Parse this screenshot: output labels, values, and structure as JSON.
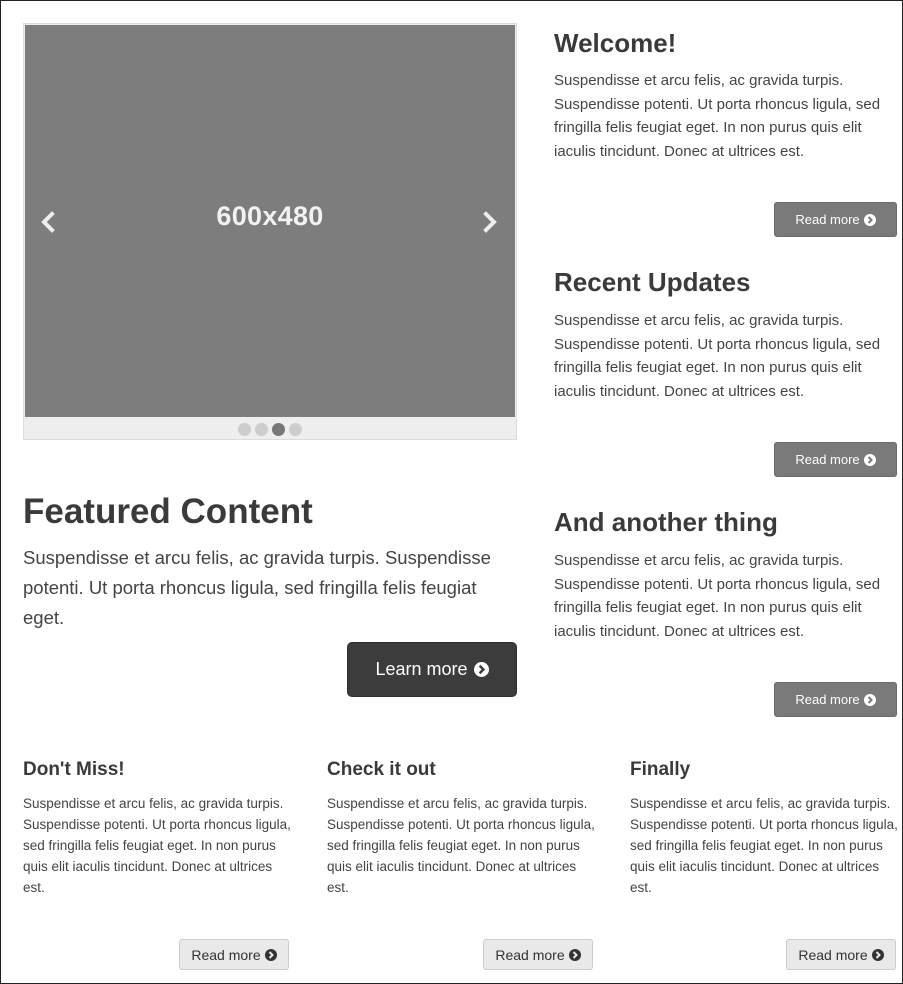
{
  "carousel": {
    "caption": "600x480",
    "prev_icon": "chevron-left-icon",
    "next_icon": "chevron-right-icon",
    "slide_count": 4,
    "active_slide": 3
  },
  "side_sections": [
    {
      "heading": "Welcome!",
      "text": "Suspendisse et arcu felis, ac gravida turpis. Suspendisse potenti. Ut porta rhoncus ligula, sed fringilla felis feugiat eget. In non purus quis elit iaculis tincidunt. Donec at ultrices est.",
      "button_label": "Read more"
    },
    {
      "heading": "Recent Updates",
      "text": "Suspendisse et arcu felis, ac gravida turpis. Suspendisse potenti. Ut porta rhoncus ligula, sed fringilla felis feugiat eget. In non purus quis elit iaculis tincidunt. Donec at ultrices est.",
      "button_label": "Read more"
    },
    {
      "heading": "And another thing",
      "text": "Suspendisse et arcu felis, ac gravida turpis. Suspendisse potenti. Ut porta rhoncus ligula, sed fringilla felis feugiat eget. In non purus quis elit iaculis tincidunt. Donec at ultrices est.",
      "button_label": "Read more"
    }
  ],
  "featured": {
    "heading": "Featured Content",
    "text": "Suspendisse et arcu felis, ac gravida turpis. Suspendisse potenti. Ut porta rhoncus ligula, sed fringilla felis feugiat eget.",
    "button_label": "Learn more"
  },
  "columns": [
    {
      "heading": "Don't Miss!",
      "text": "Suspendisse et arcu felis, ac gravida turpis. Suspendisse potenti. Ut porta rhoncus ligula, sed fringilla felis feugiat eget. In non purus quis elit iaculis tincidunt. Donec at ultrices est.",
      "button_label": "Read more"
    },
    {
      "heading": "Check it out",
      "text": "Suspendisse et arcu felis, ac gravida turpis. Suspendisse potenti. Ut porta rhoncus ligula, sed fringilla felis feugiat eget. In non purus quis elit iaculis tincidunt. Donec at ultrices est.",
      "button_label": "Read more"
    },
    {
      "heading": "Finally",
      "text": "Suspendisse et arcu felis, ac gravida turpis. Suspendisse potenti. Ut porta rhoncus ligula, sed fringilla felis feugiat eget. In non purus quis elit iaculis tincidunt. Donec at ultrices est.",
      "button_label": "Read more"
    }
  ],
  "icons": {
    "button_icon": "circle-arrow-right-icon"
  },
  "colors": {
    "carousel_bg": "#7d7d7d",
    "dark_button": "#7a7a7a",
    "learn_button": "#3c3c3c",
    "light_button": "#e9e9e9"
  }
}
